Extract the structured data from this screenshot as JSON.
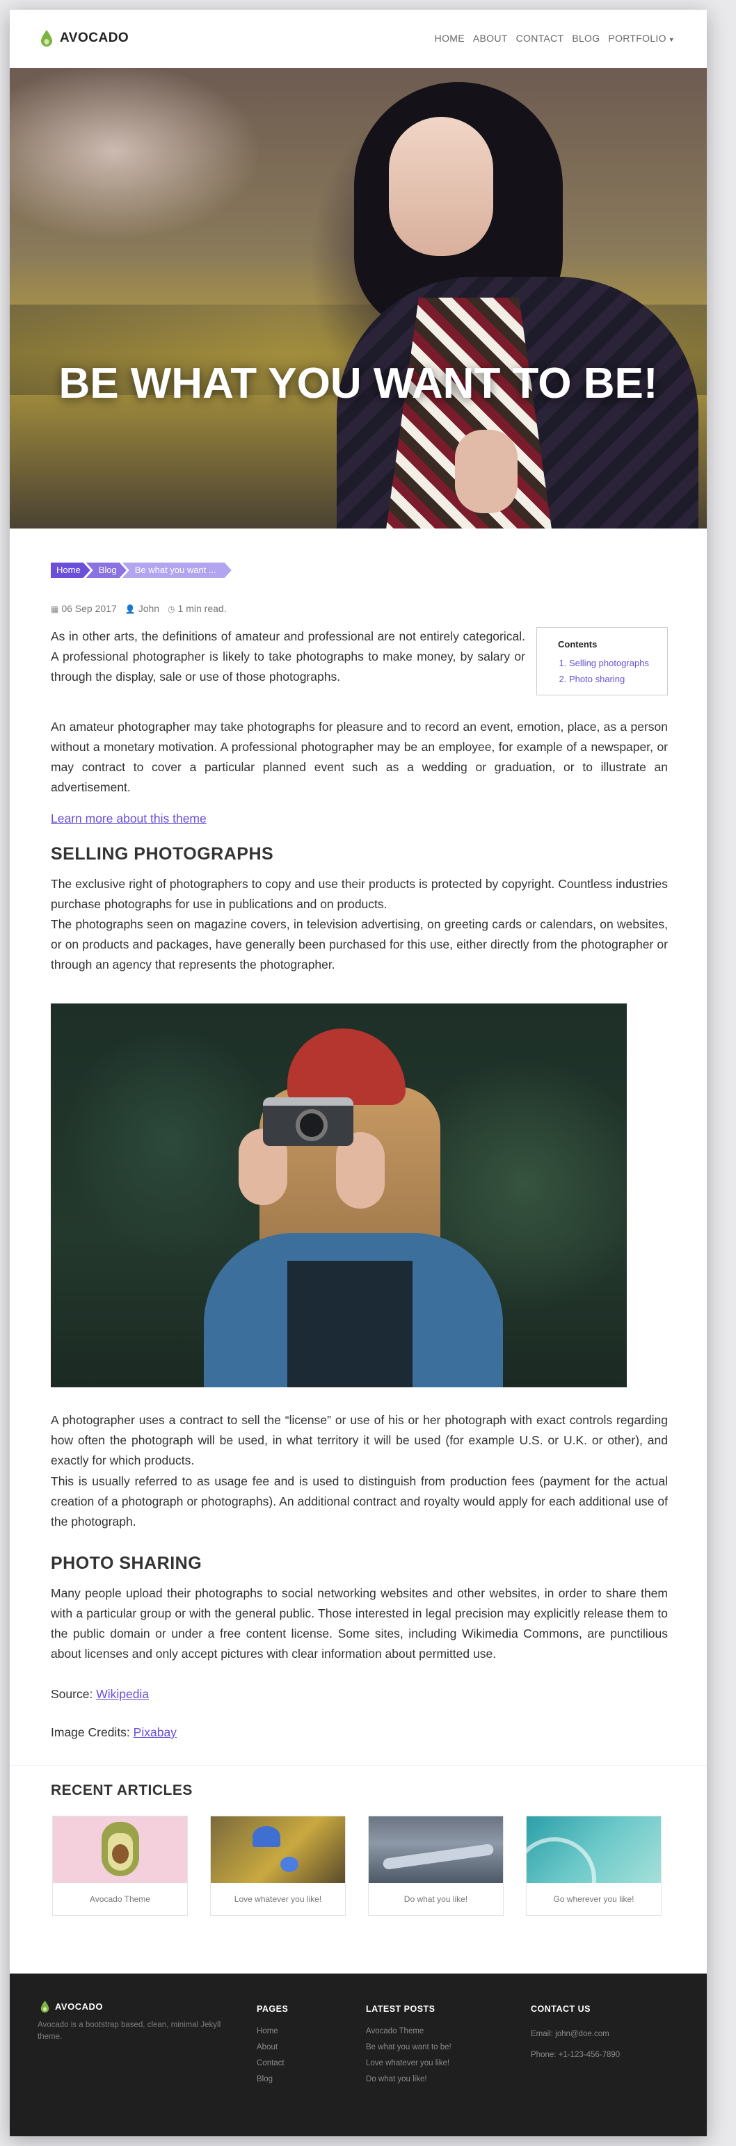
{
  "nav": {
    "brand": "AVOCADO",
    "items": [
      "HOME",
      "ABOUT",
      "CONTACT",
      "BLOG",
      "PORTFOLIO"
    ],
    "portfolio_caret": "▼"
  },
  "hero": {
    "title": "BE WHAT YOU WANT TO BE!"
  },
  "breadcrumb": [
    "Home",
    "Blog",
    "Be what you want ..."
  ],
  "meta": {
    "date": "06 Sep 2017",
    "author": "John",
    "read_time": "1 min read."
  },
  "toc": {
    "title": "Contents",
    "items": [
      "Selling photographs",
      "Photo sharing"
    ]
  },
  "article": {
    "p1": "As in other arts, the definitions of amateur and professional are not entirely categorical. A professional photographer is likely to take photographs to make money, by salary or through the display, sale or use of those photographs.",
    "p2": "An amateur photographer may take photographs for pleasure and to record an event, emotion, place, as a person without a monetary motivation. A professional photographer may be an employee, for example of a newspaper, or may contract to cover a particular planned event such as a wedding or graduation, or to illustrate an advertisement.",
    "learn_more": "Learn more about this theme",
    "h_selling": "SELLING PHOTOGRAPHS",
    "p3": "The exclusive right of photographers to copy and use their products is protected by copyright. Countless industries purchase photographs for use in publications and on products.",
    "p4": "The photographs seen on magazine covers, in television advertising, on greeting cards or calendars, on websites, or on products and packages, have generally been purchased for this use, either directly from the photographer or through an agency that represents the photographer.",
    "p5": "A photographer uses a contract to sell the “license” or use of his or her photograph with exact controls regarding how often the photograph will be used, in what territory it will be used (for example U.S. or U.K. or other), and exactly for which products.",
    "p6": "This is usually referred to as usage fee and is used to distinguish from production fees (payment for the actual creation of a photograph or photographs). An additional contract and royalty would apply for each additional use of the photograph.",
    "h_sharing": "PHOTO SHARING",
    "p7": "Many people upload their photographs to social networking websites and other websites, in order to share them with a particular group or with the general public. Those interested in legal precision may explicitly release them to the public domain or under a free content license. Some sites, including Wikimedia Commons, are punctilious about licenses and only accept pictures with clear information about permitted use.",
    "source_label": "Source:",
    "source_link": "Wikipedia",
    "credits_label": "Image Credits:",
    "credits_link": "Pixabay"
  },
  "recent": {
    "title": "RECENT ARTICLES",
    "cards": [
      "Avocado Theme",
      "Love whatever you like!",
      "Do what you like!",
      "Go wherever you like!"
    ]
  },
  "footer": {
    "brand": "AVOCADO",
    "description": "Avocado is a bootstrap based, clean, minimal Jekyll theme.",
    "pages_title": "PAGES",
    "pages": [
      "Home",
      "About",
      "Contact",
      "Blog"
    ],
    "posts_title": "LATEST POSTS",
    "posts": [
      "Avocado Theme",
      "Be what you want to be!",
      "Love whatever you like!",
      "Do what you like!"
    ],
    "contact_title": "CONTACT US",
    "email": "Email: john@doe.com",
    "phone": "Phone: +1-123-456-7890"
  },
  "colors": {
    "accent": "#6b4fd8",
    "footer_bg": "#1f1f1f",
    "logo_green": "#7cb342"
  }
}
